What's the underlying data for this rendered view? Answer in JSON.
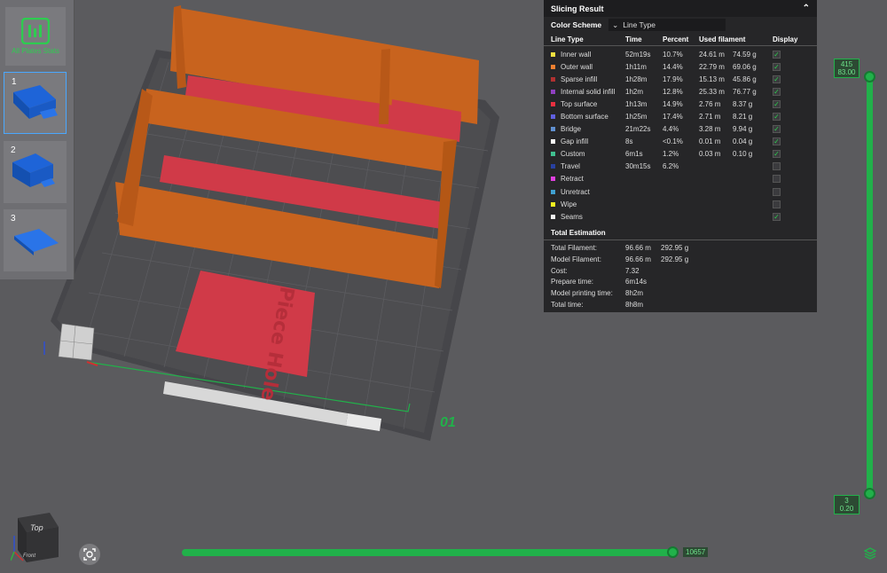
{
  "plates": {
    "stats_label": "All Plates Stats",
    "items": [
      {
        "num": "1",
        "selected": true
      },
      {
        "num": "2",
        "selected": false
      },
      {
        "num": "3",
        "selected": false
      }
    ]
  },
  "scene": {
    "plate_number": "01",
    "cube_label": "Top",
    "cube_label2": "Front"
  },
  "panel": {
    "title": "Slicing Result",
    "color_scheme_label": "Color Scheme",
    "color_scheme_value": "Line Type",
    "headers": [
      "Line Type",
      "Time",
      "Percent",
      "Used filament",
      "",
      "Display"
    ],
    "rows": [
      {
        "name": "Inner wall",
        "color": "#f0e040",
        "time": "52m19s",
        "percent": "10.7%",
        "len": "24.61 m",
        "weight": "74.59 g",
        "display": true
      },
      {
        "name": "Outer wall",
        "color": "#f08030",
        "time": "1h11m",
        "percent": "14.4%",
        "len": "22.79 m",
        "weight": "69.06 g",
        "display": true
      },
      {
        "name": "Sparse infill",
        "color": "#b03030",
        "time": "1h28m",
        "percent": "17.9%",
        "len": "15.13 m",
        "weight": "45.86 g",
        "display": true
      },
      {
        "name": "Internal solid infill",
        "color": "#9040c0",
        "time": "1h2m",
        "percent": "12.8%",
        "len": "25.33 m",
        "weight": "76.77 g",
        "display": true
      },
      {
        "name": "Top surface",
        "color": "#e83040",
        "time": "1h13m",
        "percent": "14.9%",
        "len": "2.76 m",
        "weight": "8.37 g",
        "display": true
      },
      {
        "name": "Bottom surface",
        "color": "#6060e0",
        "time": "1h25m",
        "percent": "17.4%",
        "len": "2.71 m",
        "weight": "8.21 g",
        "display": true
      },
      {
        "name": "Bridge",
        "color": "#6090d0",
        "time": "21m22s",
        "percent": "4.4%",
        "len": "3.28 m",
        "weight": "9.94 g",
        "display": true
      },
      {
        "name": "Gap infill",
        "color": "#ffffff",
        "time": "8s",
        "percent": "<0.1%",
        "len": "0.01 m",
        "weight": "0.04 g",
        "display": true
      },
      {
        "name": "Custom",
        "color": "#40c090",
        "time": "6m1s",
        "percent": "1.2%",
        "len": "0.03 m",
        "weight": "0.10 g",
        "display": true
      },
      {
        "name": "Travel",
        "color": "#2840a0",
        "time": "30m15s",
        "percent": "6.2%",
        "len": "",
        "weight": "",
        "display": false
      },
      {
        "name": "Retract",
        "color": "#e040e0",
        "time": "",
        "percent": "",
        "len": "",
        "weight": "",
        "display": false
      },
      {
        "name": "Unretract",
        "color": "#40a0d0",
        "time": "",
        "percent": "",
        "len": "",
        "weight": "",
        "display": false
      },
      {
        "name": "Wipe",
        "color": "#f0f020",
        "time": "",
        "percent": "",
        "len": "",
        "weight": "",
        "display": false
      },
      {
        "name": "Seams",
        "color": "#f0f0f0",
        "time": "",
        "percent": "",
        "len": "",
        "weight": "",
        "display": true
      }
    ],
    "estimation_title": "Total Estimation",
    "estimation": [
      {
        "label": "Total Filament:",
        "v1": "96.66 m",
        "v2": "292.95 g"
      },
      {
        "label": "Model Filament:",
        "v1": "96.66 m",
        "v2": "292.95 g"
      },
      {
        "label": "Cost:",
        "v1": "7.32",
        "v2": ""
      },
      {
        "label": "Prepare time:",
        "v1": "6m14s",
        "v2": ""
      },
      {
        "label": "Model printing time:",
        "v1": "8h2m",
        "v2": ""
      },
      {
        "label": "Total time:",
        "v1": "8h8m",
        "v2": ""
      }
    ]
  },
  "sliders": {
    "horizontal_value": "10657",
    "vertical_top_layer": "415",
    "vertical_top_height": "83.00",
    "vertical_bottom_layer": "3",
    "vertical_bottom_height": "0.20"
  },
  "colors": {
    "accent": "#21b14a",
    "wall": "#c8631e",
    "infill": "#d03a48"
  }
}
